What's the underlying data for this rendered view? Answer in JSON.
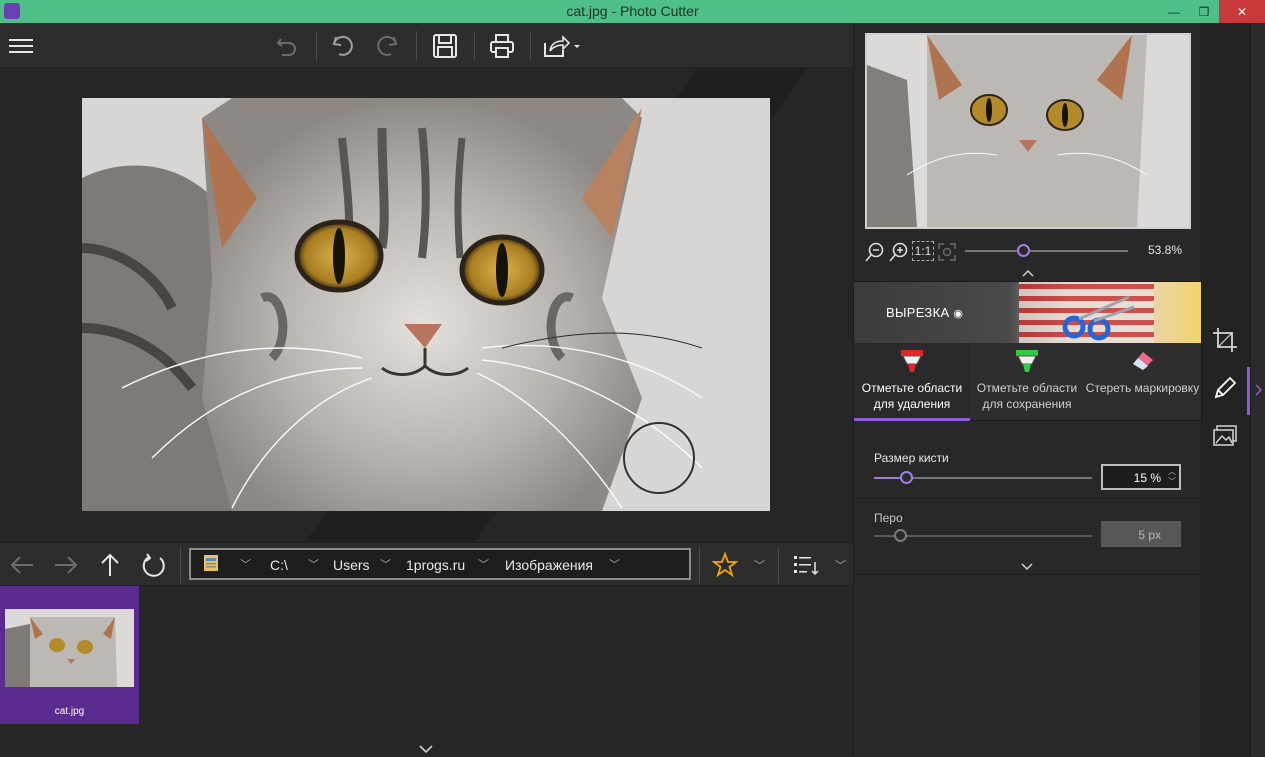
{
  "window": {
    "title": "cat.jpg - Photo Cutter",
    "controls": {
      "minimize": "—",
      "restore": "❐",
      "close": "✕"
    }
  },
  "toolbar": {
    "menu_icon": "hamburger-icon",
    "buttons": [
      "undo-all-icon",
      "undo-icon",
      "redo-icon",
      "save-icon",
      "print-icon",
      "share-icon"
    ]
  },
  "canvas": {
    "image": "cat.jpg"
  },
  "navigation": {
    "path": [
      "C:\\",
      "Users",
      "1progs.ru",
      "Изображения"
    ],
    "icons": [
      "back-arrow-icon",
      "forward-arrow-icon",
      "up-arrow-icon",
      "refresh-icon",
      "folder-icon",
      "star-icon",
      "sort-list-icon"
    ],
    "accent": "#f0a500"
  },
  "thumbnails": [
    {
      "name": "cat.jpg",
      "selected": true
    }
  ],
  "preview": {
    "zoom_label": "53.8%",
    "zoom_fraction": 0.36,
    "fit_label": "1:1"
  },
  "cutout": {
    "title": "ВЫРЕЗКА",
    "tabs": [
      {
        "line1": "Отметьте области",
        "line2": "для удаления",
        "color": "#e02626",
        "active": true
      },
      {
        "line1": "Отметьте области",
        "line2": "для сохранения",
        "color": "#2ecc40",
        "active": false
      },
      {
        "line1": "Стереть маркировку",
        "line2": "",
        "color": "#f06a8a",
        "active": false
      }
    ]
  },
  "brush_size": {
    "label": "Размер кисти",
    "value": "15 %",
    "fraction": 0.15
  },
  "feather": {
    "label": "Перо",
    "value": "5 px",
    "fraction": 0.12
  },
  "colors": {
    "titlebar": "#4fbf8a",
    "accent": "#8e5ad6",
    "close": "#c83a3a"
  }
}
